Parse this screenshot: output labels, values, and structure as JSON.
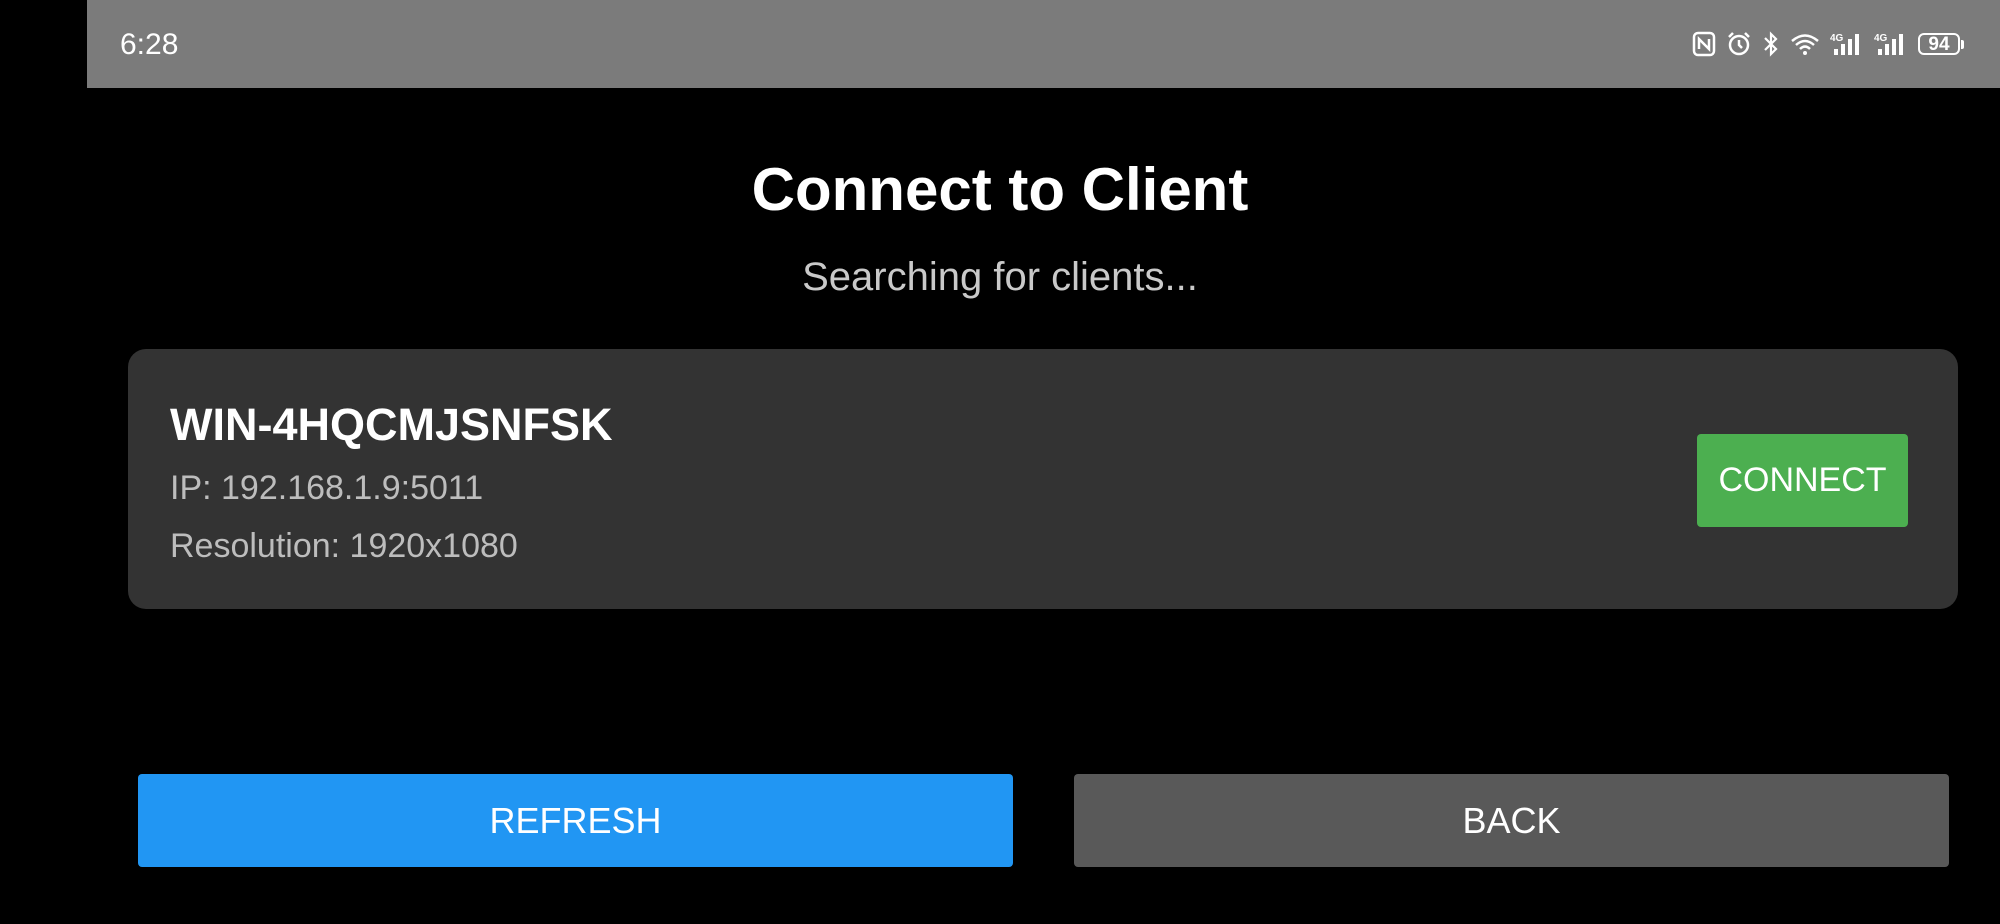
{
  "status_bar": {
    "time": "6:28",
    "battery_level": "94",
    "icons": [
      "nfc-icon",
      "alarm-icon",
      "bluetooth-icon",
      "wifi-icon",
      "signal-4g-icon",
      "signal-4g-icon",
      "battery-icon"
    ]
  },
  "screen": {
    "title": "Connect to Client",
    "subtitle": "Searching for clients..."
  },
  "client": {
    "name": "WIN-4HQCMJSNFSK",
    "ip": "IP: 192.168.1.9:5011",
    "resolution": "Resolution: 1920x1080",
    "connect_label": "CONNECT"
  },
  "actions": {
    "refresh_label": "REFRESH",
    "back_label": "BACK"
  },
  "colors": {
    "background": "#000000",
    "status_bar": "#7b7b7b",
    "card": "#333333",
    "connect": "#4caf50",
    "refresh": "#2196f3",
    "back": "#595959"
  }
}
